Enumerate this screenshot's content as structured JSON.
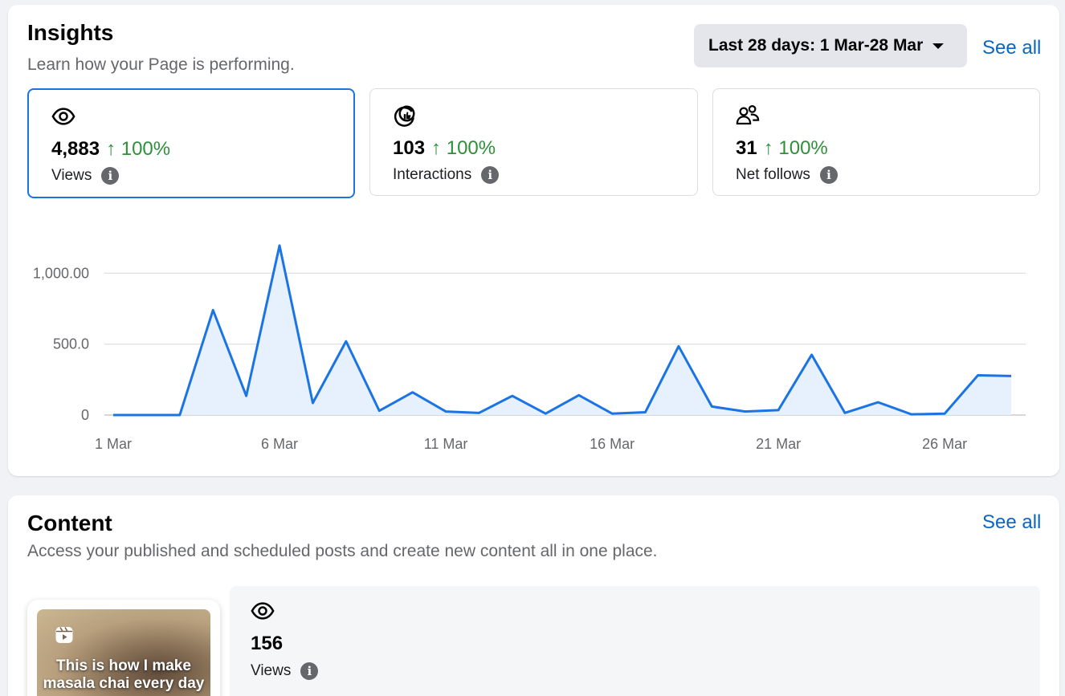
{
  "insights": {
    "title": "Insights",
    "subtitle": "Learn how your Page is performing.",
    "date_range_label": "Last 28 days: 1 Mar-28 Mar",
    "see_all_label": "See all",
    "metrics": [
      {
        "icon": "eye-icon",
        "value": "4,883",
        "change": "100%",
        "label": "Views",
        "selected": true
      },
      {
        "icon": "like-interactions-icon",
        "value": "103",
        "change": "100%",
        "label": "Interactions",
        "selected": false
      },
      {
        "icon": "people-follow-icon",
        "value": "31",
        "change": "100%",
        "label": "Net follows",
        "selected": false
      }
    ]
  },
  "chart_data": {
    "type": "area",
    "series": [
      {
        "values": [
          0,
          0,
          0,
          740,
          135,
          1195,
          85,
          520,
          30,
          160,
          25,
          15,
          135,
          10,
          140,
          10,
          20,
          485,
          60,
          25,
          35,
          425,
          15,
          90,
          5,
          10,
          280,
          275
        ]
      }
    ],
    "x": [
      "1 Mar",
      "2 Mar",
      "3 Mar",
      "4 Mar",
      "5 Mar",
      "6 Mar",
      "7 Mar",
      "8 Mar",
      "9 Mar",
      "10 Mar",
      "11 Mar",
      "12 Mar",
      "13 Mar",
      "14 Mar",
      "15 Mar",
      "16 Mar",
      "17 Mar",
      "18 Mar",
      "19 Mar",
      "20 Mar",
      "21 Mar",
      "22 Mar",
      "23 Mar",
      "24 Mar",
      "25 Mar",
      "26 Mar",
      "27 Mar",
      "28 Mar"
    ],
    "x_tick_labels": [
      "1 Mar",
      "6 Mar",
      "11 Mar",
      "16 Mar",
      "21 Mar",
      "26 Mar"
    ],
    "y_ticks": [
      0,
      500,
      1000
    ],
    "y_tick_labels": [
      "0",
      "500.0",
      "1,000.00"
    ],
    "ylim": [
      0,
      1200
    ],
    "grid": true,
    "colors": {
      "line": "#1b74e4",
      "fill": "#e7f0fd",
      "grid": "#dadde1"
    }
  },
  "content": {
    "title": "Content",
    "subtitle": "Access your published and scheduled posts and create new content all in one place.",
    "see_all_label": "See all",
    "post": {
      "thumbnail_caption": "This is how I make masala chai every day",
      "thumbnail_icon": "reels-icon",
      "stat_icon": "eye-icon",
      "stat_value": "156",
      "stat_label": "Views"
    }
  },
  "colors": {
    "accent": "#1b74e4",
    "link": "#0a66c2",
    "positive": "#2f8f3a",
    "button_bg": "#e4e6eb"
  }
}
